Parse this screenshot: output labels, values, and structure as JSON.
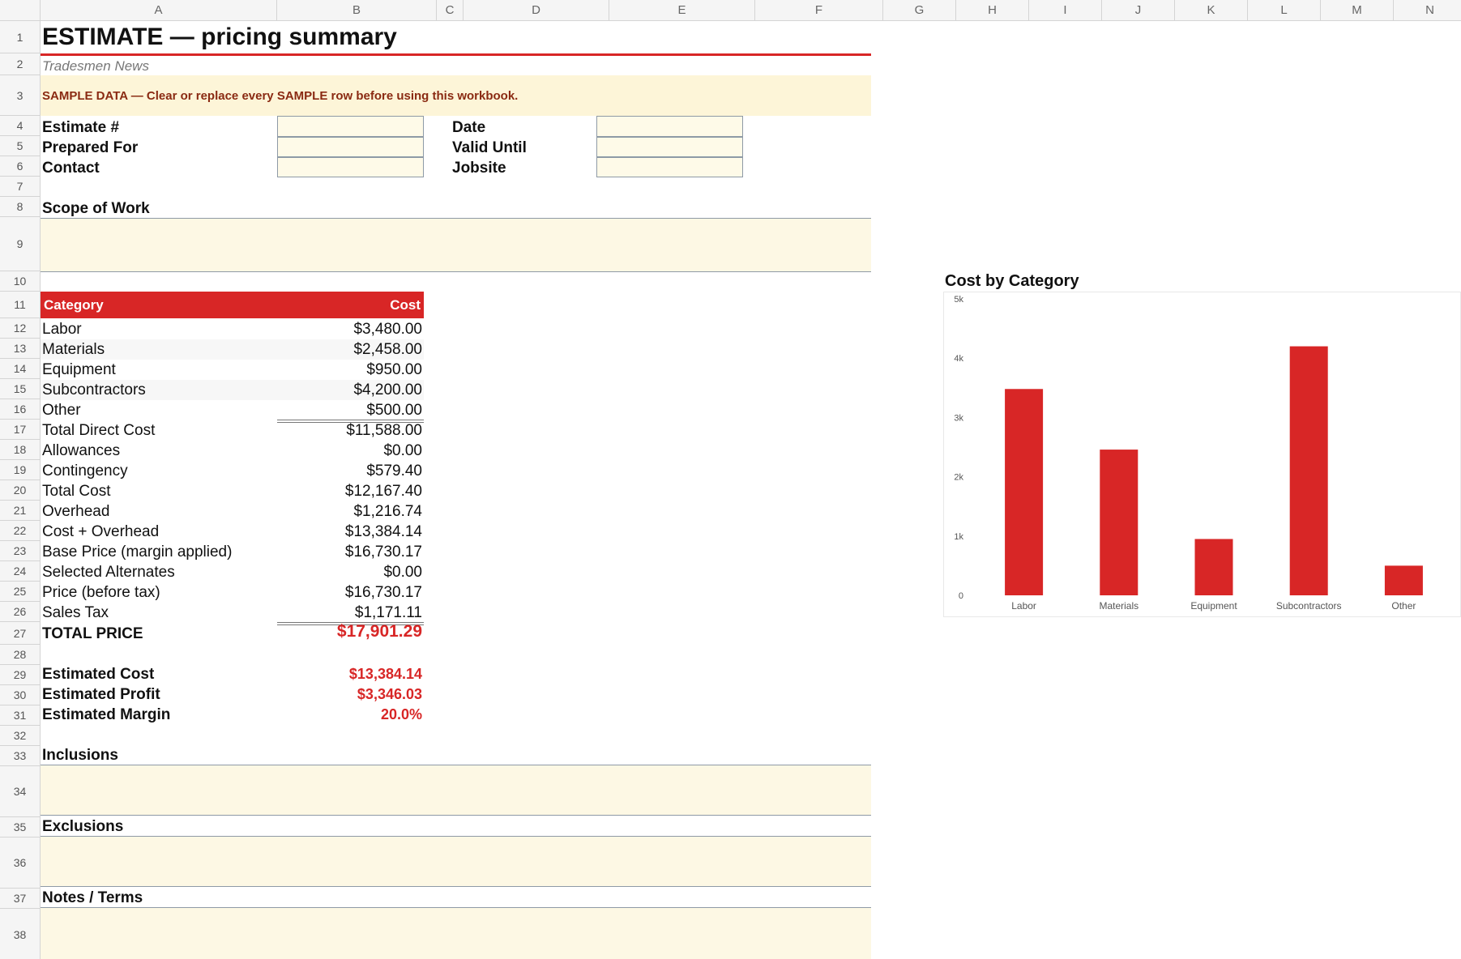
{
  "columns": [
    "A",
    "B",
    "C",
    "D",
    "E",
    "F",
    "G",
    "H",
    "I",
    "J",
    "K",
    "L",
    "M",
    "N"
  ],
  "rows": [
    "1",
    "2",
    "3",
    "4",
    "5",
    "6",
    "7",
    "8",
    "9",
    "10",
    "11",
    "12",
    "13",
    "14",
    "15",
    "16",
    "17",
    "18",
    "19",
    "20",
    "21",
    "22",
    "23",
    "24",
    "25",
    "26",
    "27",
    "28",
    "29",
    "30",
    "31",
    "32",
    "33",
    "34",
    "35",
    "36",
    "37",
    "38"
  ],
  "title": "ESTIMATE — pricing summary",
  "subtitle": "Tradesmen News",
  "banner": "SAMPLE DATA — Clear or replace every SAMPLE row before using this workbook.",
  "fields": {
    "estimate_no": "Estimate #",
    "prepared_for": "Prepared For",
    "contact": "Contact",
    "date": "Date",
    "valid_until": "Valid Until",
    "jobsite": "Jobsite"
  },
  "scope_label": "Scope of Work",
  "table_header": {
    "category": "Category",
    "cost": "Cost"
  },
  "lines": [
    {
      "label": "Labor",
      "value": "$3,480.00"
    },
    {
      "label": "Materials",
      "value": "$2,458.00"
    },
    {
      "label": "Equipment",
      "value": "$950.00"
    },
    {
      "label": "Subcontractors",
      "value": "$4,200.00"
    },
    {
      "label": "Other",
      "value": "$500.00"
    },
    {
      "label": "Total Direct Cost",
      "value": "$11,588.00"
    },
    {
      "label": "Allowances",
      "value": "$0.00"
    },
    {
      "label": "Contingency",
      "value": "$579.40"
    },
    {
      "label": "Total Cost",
      "value": "$12,167.40"
    },
    {
      "label": "Overhead",
      "value": "$1,216.74"
    },
    {
      "label": "Cost + Overhead",
      "value": "$13,384.14"
    },
    {
      "label": "Base Price (margin applied)",
      "value": "$16,730.17"
    },
    {
      "label": "Selected Alternates",
      "value": "$0.00"
    },
    {
      "label": "Price (before tax)",
      "value": "$16,730.17"
    },
    {
      "label": "Sales Tax",
      "value": "$1,171.11"
    }
  ],
  "total_price": {
    "label": "TOTAL PRICE",
    "value": "$17,901.29"
  },
  "summary": [
    {
      "label": "Estimated Cost",
      "value": "$13,384.14"
    },
    {
      "label": "Estimated Profit",
      "value": "$3,346.03"
    },
    {
      "label": "Estimated Margin",
      "value": "20.0%"
    }
  ],
  "sections": {
    "inclusions": "Inclusions",
    "exclusions": "Exclusions",
    "notes": "Notes / Terms"
  },
  "colors": {
    "accent": "#d82626",
    "input_fill": "#fefae8",
    "banner_fill": "#fdf5d8"
  },
  "chart_data": {
    "type": "bar",
    "title": "Cost by Category",
    "categories": [
      "Labor",
      "Materials",
      "Equipment",
      "Subcontractors",
      "Other"
    ],
    "values": [
      3480,
      2458,
      950,
      4200,
      500
    ],
    "ylim": [
      0,
      5000
    ],
    "yticks": [
      "0",
      "1k",
      "2k",
      "3k",
      "4k",
      "5k"
    ],
    "color": "#d82626",
    "grid": false,
    "legend": false
  }
}
